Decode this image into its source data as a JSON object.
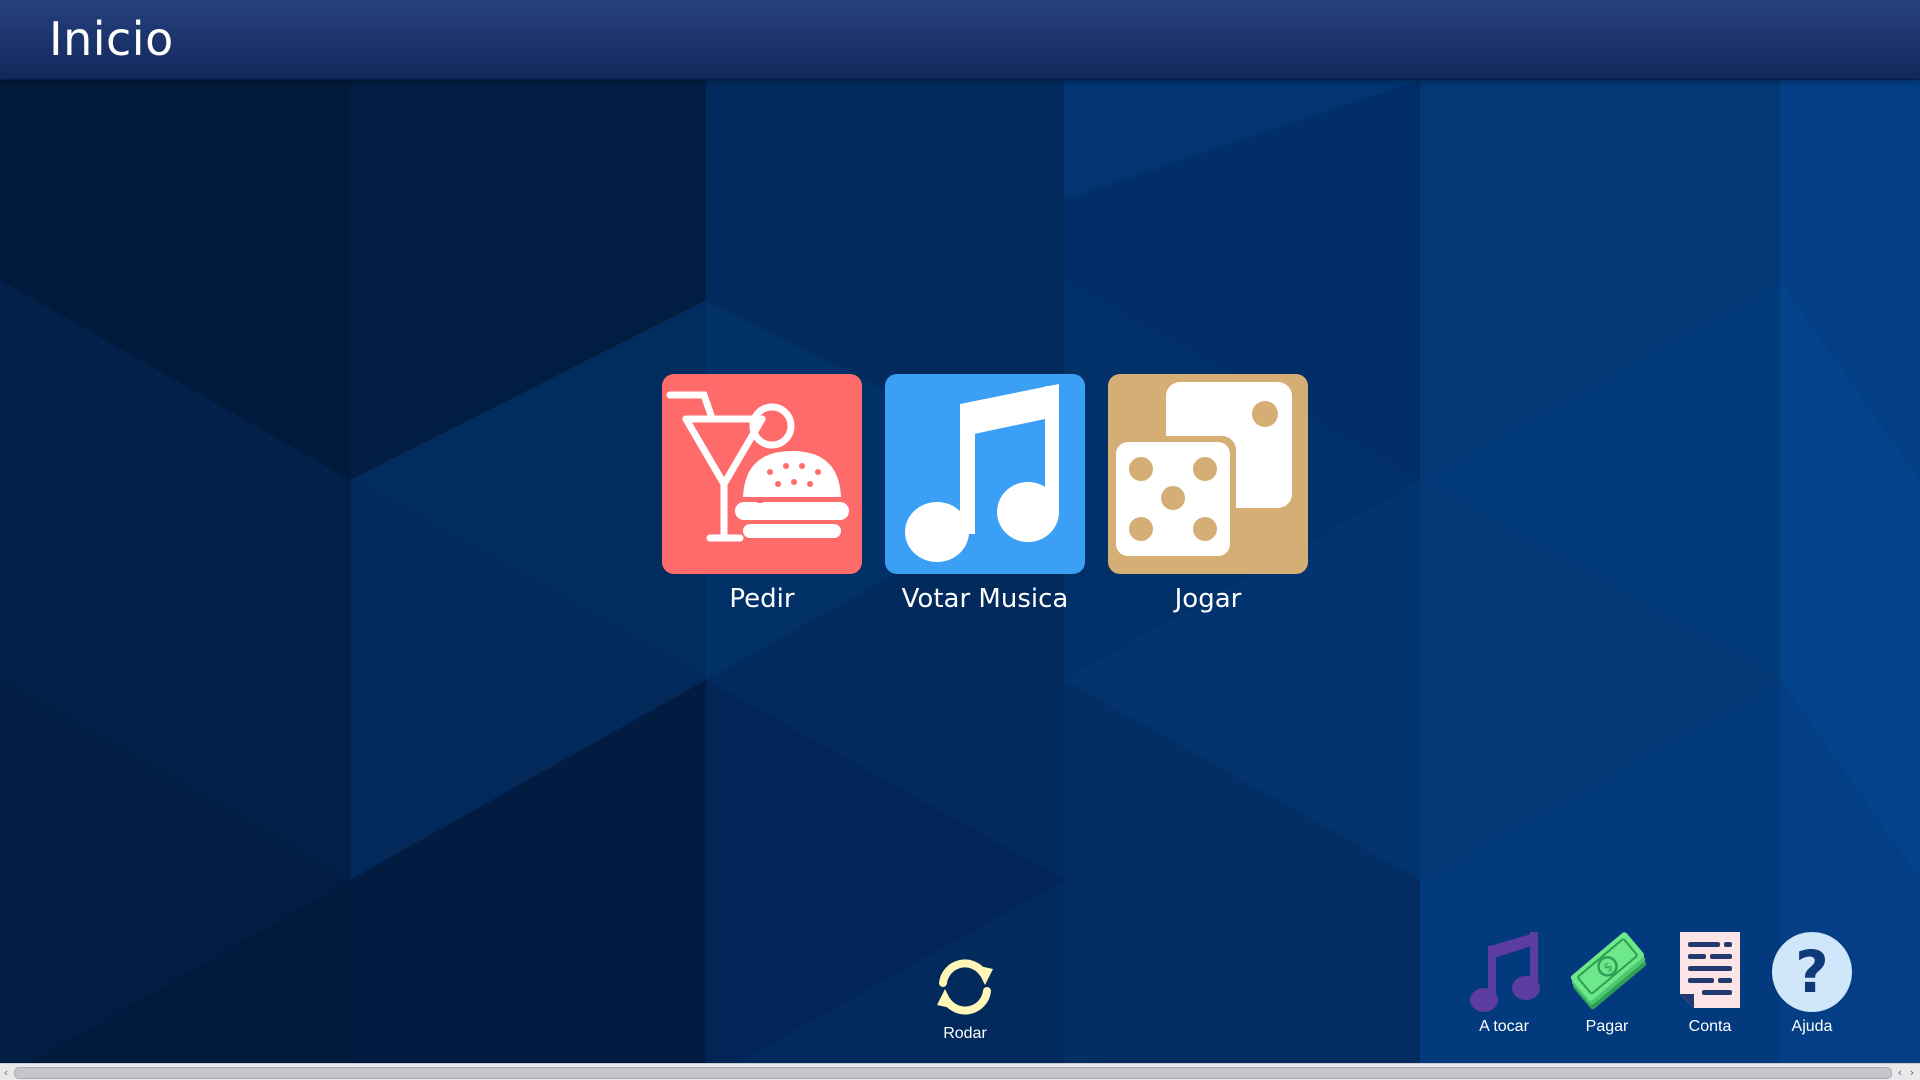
{
  "header": {
    "title": "Inicio"
  },
  "tiles": [
    {
      "label": "Pedir",
      "icon": "food-drink-icon",
      "color": "#ff6b6b"
    },
    {
      "label": "Votar Musica",
      "icon": "music-note-icon",
      "color": "#3a9ff5"
    },
    {
      "label": "Jogar",
      "icon": "dice-icon",
      "color": "#d4ae74"
    }
  ],
  "rodar": {
    "label": "Rodar",
    "icon": "rotate-icon",
    "color": "#fff6b8"
  },
  "dock": [
    {
      "label": "A tocar",
      "icon": "now-playing-icon",
      "color": "#5c3c9e"
    },
    {
      "label": "Pagar",
      "icon": "pay-money-icon",
      "color": "#6de88a"
    },
    {
      "label": "Conta",
      "icon": "bill-receipt-icon",
      "color": "#fde5e7"
    },
    {
      "label": "Ajuda",
      "icon": "help-icon",
      "color": "#cfe6fb"
    }
  ],
  "colors": {
    "header": "#1c3370",
    "background": "#022a5e"
  }
}
